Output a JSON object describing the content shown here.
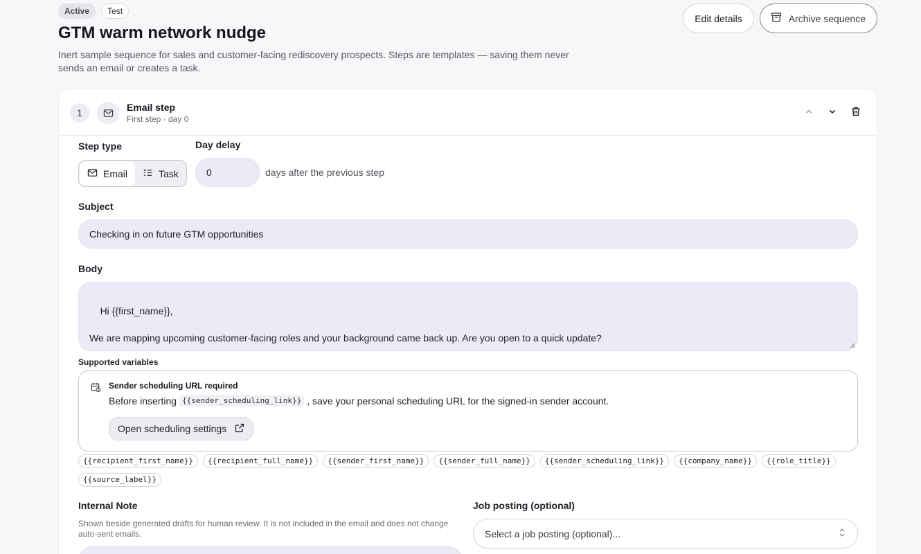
{
  "header": {
    "badges": [
      "Active",
      "Test"
    ],
    "title": "GTM warm network nudge",
    "description": "Inert sample sequence for sales and customer-facing rediscovery prospects. Steps are templates — saving them never sends an email or creates a task.",
    "edit_label": "Edit details",
    "archive_label": "Archive sequence"
  },
  "step": {
    "number": "1",
    "title": "Email step",
    "subtitle": "First step · day 0",
    "step_type_label": "Step type",
    "type_options": [
      "Email",
      "Task"
    ],
    "selected_type": "Email",
    "day_delay_label": "Day delay",
    "day_delay_value": "0",
    "day_delay_suffix": "days after the previous step",
    "subject_label": "Subject",
    "subject_value": "Checking in on future GTM opportunities",
    "body_label": "Body",
    "body_value": "Hi {{first_name}},\n\nWe are mapping upcoming customer-facing roles and your background came back up. Are you open to a quick update?",
    "supported_variables_label": "Supported variables",
    "alert": {
      "title": "Sender scheduling URL required",
      "text_before": "Before inserting",
      "code": "{{sender_scheduling_link}}",
      "text_after": ", save your personal scheduling URL for the signed-in sender account.",
      "button_label": "Open scheduling settings"
    },
    "variables": [
      "{{recipient_first_name}}",
      "{{recipient_full_name}}",
      "{{sender_first_name}}",
      "{{sender_full_name}}",
      "{{sender_scheduling_link}}",
      "{{company_name}}",
      "{{role_title}}",
      "{{source_label}}"
    ],
    "internal_note_label": "Internal Note",
    "internal_note_help": "Shown beside generated drafts for human review. It is not included in the email and does not change auto-sent emails.",
    "job_posting_label": "Job posting (optional)",
    "job_posting_placeholder": "Select a job posting (optional)..."
  }
}
